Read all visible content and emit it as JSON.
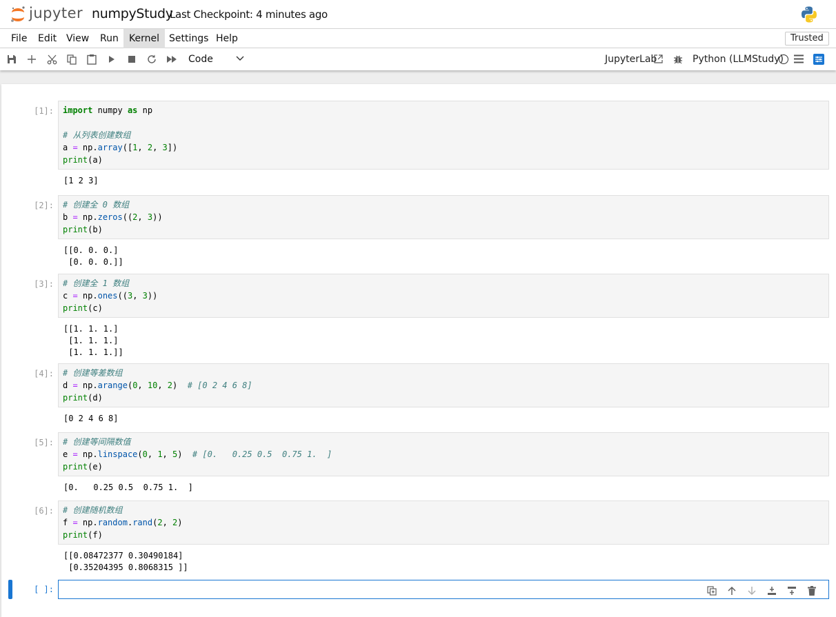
{
  "header": {
    "logo_text": "jupyter",
    "notebook_name": "numpyStudy",
    "checkpoint": "Last Checkpoint: 4 minutes ago"
  },
  "menu": {
    "items": [
      "File",
      "Edit",
      "View",
      "Run",
      "Kernel",
      "Settings",
      "Help"
    ],
    "active_index": 4,
    "trusted_label": "Trusted"
  },
  "toolbar": {
    "cell_type": "Code",
    "lab_link": "JupyterLab",
    "kernel_name": "Python (LLMStudy)",
    "icons": [
      "save-icon",
      "add-cell-icon",
      "cut-icon",
      "copy-icon",
      "paste-icon",
      "run-icon",
      "stop-icon",
      "restart-icon",
      "fast-forward-icon"
    ]
  },
  "cells": [
    {
      "prompt": "[1]:",
      "code": [
        [
          [
            "kw",
            "import"
          ],
          [
            "",
            " numpy "
          ],
          [
            "kw",
            "as"
          ],
          [
            "",
            " np"
          ]
        ],
        [
          [
            "",
            ""
          ]
        ],
        [
          [
            "cm",
            "# 从列表创建数组"
          ]
        ],
        [
          [
            "",
            "a "
          ],
          [
            "op",
            "="
          ],
          [
            "",
            " np."
          ],
          [
            "fn",
            "array"
          ],
          [
            "",
            "(["
          ],
          [
            "nm",
            "1"
          ],
          [
            "",
            ", "
          ],
          [
            "nm",
            "2"
          ],
          [
            "",
            ", "
          ],
          [
            "nm",
            "3"
          ],
          [
            "",
            "])"
          ]
        ],
        [
          [
            "bi",
            "print"
          ],
          [
            "",
            "(a)"
          ]
        ]
      ],
      "output": [
        "[1 2 3]"
      ]
    },
    {
      "prompt": "[2]:",
      "code": [
        [
          [
            "cm",
            "# 创建全 0 数组"
          ]
        ],
        [
          [
            "",
            "b "
          ],
          [
            "op",
            "="
          ],
          [
            "",
            " np."
          ],
          [
            "fn",
            "zeros"
          ],
          [
            "",
            "(("
          ],
          [
            "nm",
            "2"
          ],
          [
            "",
            ", "
          ],
          [
            "nm",
            "3"
          ],
          [
            "",
            "))"
          ]
        ],
        [
          [
            "bi",
            "print"
          ],
          [
            "",
            "(b)"
          ]
        ]
      ],
      "output": [
        "[[0. 0. 0.]",
        " [0. 0. 0.]]"
      ]
    },
    {
      "prompt": "[3]:",
      "code": [
        [
          [
            "cm",
            "# 创建全 1 数组"
          ]
        ],
        [
          [
            "",
            "c "
          ],
          [
            "op",
            "="
          ],
          [
            "",
            " np."
          ],
          [
            "fn",
            "ones"
          ],
          [
            "",
            "(("
          ],
          [
            "nm",
            "3"
          ],
          [
            "",
            ", "
          ],
          [
            "nm",
            "3"
          ],
          [
            "",
            "))"
          ]
        ],
        [
          [
            "bi",
            "print"
          ],
          [
            "",
            "(c)"
          ]
        ]
      ],
      "output": [
        "[[1. 1. 1.]",
        " [1. 1. 1.]",
        " [1. 1. 1.]]"
      ]
    },
    {
      "prompt": "[4]:",
      "code": [
        [
          [
            "cm",
            "# 创建等差数组"
          ]
        ],
        [
          [
            "",
            "d "
          ],
          [
            "op",
            "="
          ],
          [
            "",
            " np."
          ],
          [
            "fn",
            "arange"
          ],
          [
            "",
            "("
          ],
          [
            "nm",
            "0"
          ],
          [
            "",
            ", "
          ],
          [
            "nm",
            "10"
          ],
          [
            "",
            ", "
          ],
          [
            "nm",
            "2"
          ],
          [
            "",
            ")  "
          ],
          [
            "cm",
            "# [0 2 4 6 8]"
          ]
        ],
        [
          [
            "bi",
            "print"
          ],
          [
            "",
            "(d)"
          ]
        ]
      ],
      "output": [
        "[0 2 4 6 8]"
      ]
    },
    {
      "prompt": "[5]:",
      "code": [
        [
          [
            "cm",
            "# 创建等间隔数值"
          ]
        ],
        [
          [
            "",
            "e "
          ],
          [
            "op",
            "="
          ],
          [
            "",
            " np."
          ],
          [
            "fn",
            "linspace"
          ],
          [
            "",
            "("
          ],
          [
            "nm",
            "0"
          ],
          [
            "",
            ", "
          ],
          [
            "nm",
            "1"
          ],
          [
            "",
            ", "
          ],
          [
            "nm",
            "5"
          ],
          [
            "",
            ")  "
          ],
          [
            "cm",
            "# [0.   0.25 0.5  0.75 1.  ]"
          ]
        ],
        [
          [
            "bi",
            "print"
          ],
          [
            "",
            "(e)"
          ]
        ]
      ],
      "output": [
        "[0.   0.25 0.5  0.75 1.  ]"
      ]
    },
    {
      "prompt": "[6]:",
      "code": [
        [
          [
            "cm",
            "# 创建随机数组"
          ]
        ],
        [
          [
            "",
            "f "
          ],
          [
            "op",
            "="
          ],
          [
            "",
            " np."
          ],
          [
            "fn",
            "random"
          ],
          [
            "",
            "."
          ],
          [
            "fn",
            "rand"
          ],
          [
            "",
            "("
          ],
          [
            "nm",
            "2"
          ],
          [
            "",
            ", "
          ],
          [
            "nm",
            "2"
          ],
          [
            "",
            ")"
          ]
        ],
        [
          [
            "bi",
            "print"
          ],
          [
            "",
            "(f)"
          ]
        ]
      ],
      "output": [
        "[[0.08472377 0.30490184]",
        " [0.35204395 0.8068315 ]]"
      ]
    }
  ],
  "empty_cell": {
    "prompt": "[ ]:",
    "actions": [
      "duplicate-cell-icon",
      "move-up-icon",
      "move-down-icon",
      "insert-above-icon",
      "insert-below-icon",
      "delete-cell-icon"
    ]
  }
}
